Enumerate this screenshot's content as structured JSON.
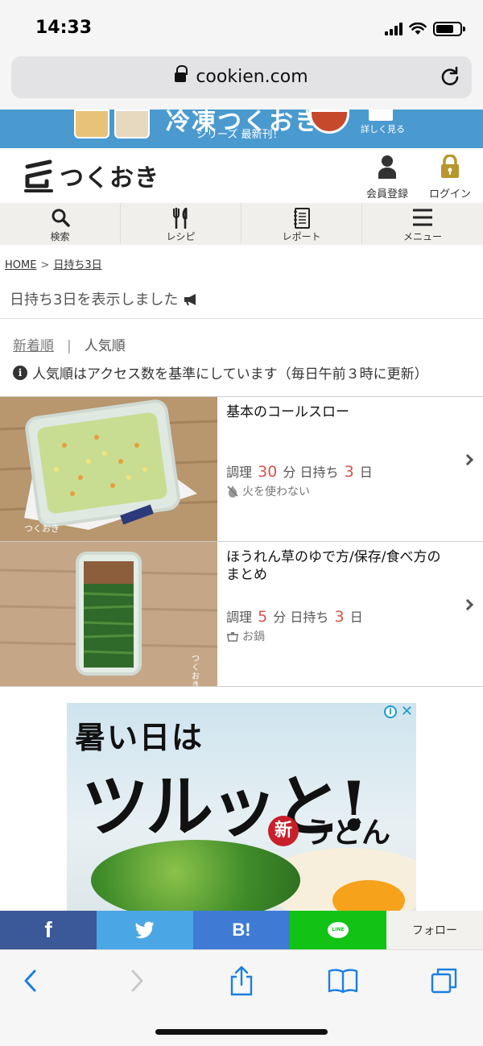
{
  "status": {
    "time": "14:33",
    "battery_level": 0.75
  },
  "browser": {
    "url": "cookien.com"
  },
  "banner": {
    "title": "冷凍つくおき",
    "subtitle": "シリーズ 最新刊！",
    "more": "詳しく見る"
  },
  "header": {
    "logo": "つくおき",
    "register": "会員登録",
    "login": "ログイン"
  },
  "nav": [
    {
      "label": "検索",
      "icon": "search-icon"
    },
    {
      "label": "レシピ",
      "icon": "utensils-icon"
    },
    {
      "label": "レポート",
      "icon": "notebook-icon"
    },
    {
      "label": "メニュー",
      "icon": "hamburger-icon"
    }
  ],
  "breadcrumb": {
    "home": "HOME",
    "separator": ">",
    "current": "日持ち3日"
  },
  "page_title": "日持ち3日を表示しました",
  "sort": {
    "newest": "新着順",
    "separator": "|",
    "popular": "人気順"
  },
  "notice": "人気順はアクセス数を基準にしています（毎日午前３時に更新）",
  "recipes": [
    {
      "title": "基本のコールスロー",
      "cook_label": "調理",
      "cook_time": "30",
      "minutes": "分",
      "keep_label": "日持ち",
      "keep_days": "3",
      "days": "日",
      "tag": "火を使わない",
      "tag_icon": "no-fire-icon",
      "photo_watermark": "つくおき"
    },
    {
      "title": "ほうれん草のゆで方/保存/食べ方のまとめ",
      "cook_label": "調理",
      "cook_time": "5",
      "minutes": "分",
      "keep_label": "日持ち",
      "keep_days": "3",
      "days": "日",
      "tag": "お鍋",
      "tag_icon": "pot-icon",
      "photo_watermark": "つくおき"
    }
  ],
  "ad": {
    "line1": "暑い日は",
    "line2": "ツルッと!",
    "badge": "新",
    "product": "うどん",
    "info": "i",
    "close": "✕"
  },
  "share": {
    "facebook": "f",
    "hatena": "B!",
    "line": "LINE",
    "follow": "フォロー"
  },
  "colors": {
    "accent_red": "#d7524b",
    "banner_blue": "#4a9ad0",
    "facebook": "#3b5998",
    "twitter": "#4aa6e5",
    "hatena": "#3f7bd4",
    "line": "#12c316",
    "safari_blue": "#1a7fe0"
  }
}
